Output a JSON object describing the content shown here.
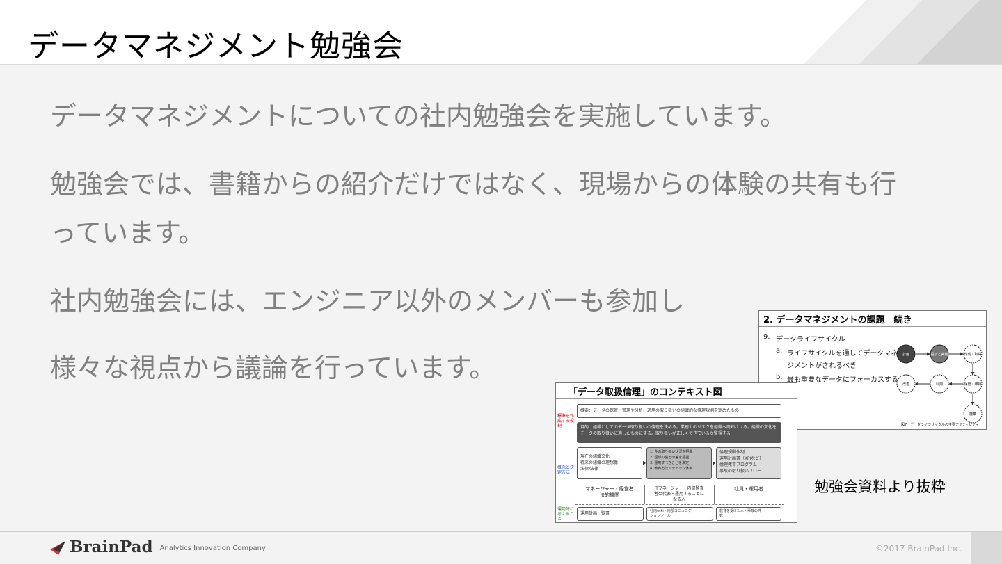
{
  "header": {
    "title": "データマネジメント勉強会"
  },
  "body": {
    "paragraphs": [
      "データマネジメントについての社内勉強会を実施しています。",
      "勉強会では、書籍からの紹介だけではなく、現場からの体験の共有も行",
      "っています。",
      "社内勉強会には、エンジニア以外のメンバーも参加し",
      "様々な視点から議論を行っています。"
    ]
  },
  "slide_lifecycle": {
    "title": "2. データマネジメントの課題　続き",
    "item_number": "9.",
    "item_label": "データライフサイクル",
    "sub_a_marker": "a.",
    "sub_a_line1": "ライフサイクルを通してデータマネ",
    "sub_a_line2": "ジメントがされるべき",
    "sub_b_marker": "b.",
    "sub_b": "最も重要なデータにフォーカスする",
    "nodes": [
      "計画",
      "設計と実装",
      "作成・取得",
      "保管・維持",
      "利用",
      "改善",
      "廃棄"
    ],
    "source": "図7　データライフサイクルの主要アクティビティ"
  },
  "slide_ethics": {
    "title": "「データ取扱倫理」のコンテキスト図",
    "side_labels": [
      "標準を作成する役割",
      "概念と決定方法",
      "運用時に考えること"
    ],
    "overview": "概要：データの保管・管理や分析、適用の取り扱いの組織的な倫理規則を定めたもの",
    "goal": "目的：組織としてのデータ取り扱いの倫理を決める。業務上のリスクを組織へ周知させる。組織の文化をデータの取り扱いに適したものにする。取り扱いが正しくできているか監視する",
    "box_left": "現在の組織文化\n将来の組織の理想像\n法律/法律",
    "box_mid": "1. 今の取り扱い状況を把握\n2. 理想の姿との差を把握\n3. 運用すべきことを決定\n4. 教育方法・チェック体制",
    "box_right": "倫理規則体制\n運用計画書（KPIなど）\n倫理教育プログラム\n事故の取り扱いフロー",
    "col1": "マネージャー・経営者\n法的機関",
    "col2": "ITマネージャー・内部監査\n者の代表・運用することに\nなる人",
    "col3": "社員・運用者",
    "bottom1": "運用計画一覧書",
    "bottom2": "社内wiki・内部コミュニケー\nションツール",
    "bottom3": "教育を受けた人・事故の件\n数"
  },
  "caption": "勉強会資料より抜粋",
  "footer": {
    "logo_text": "BrainPad",
    "logo_tagline": "Analytics Innovation Company",
    "copyright": "©2017 BrainPad Inc."
  }
}
